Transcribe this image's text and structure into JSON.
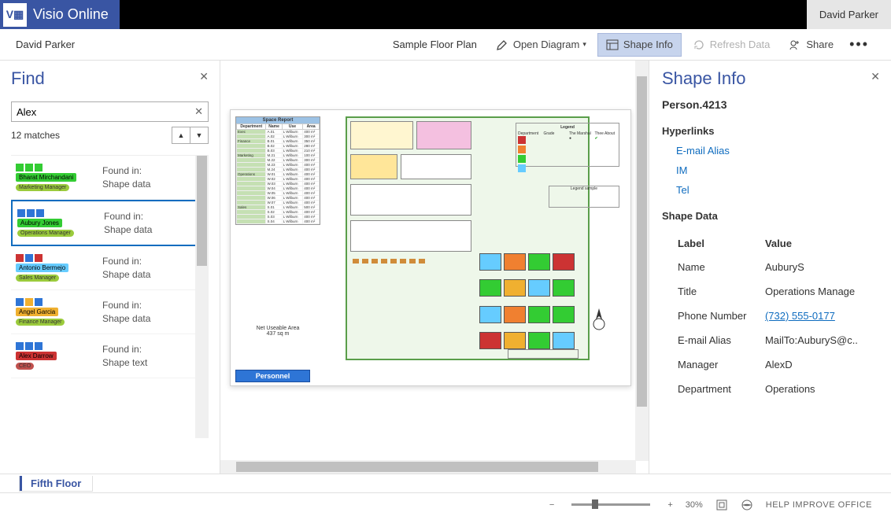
{
  "app": {
    "name": "Visio Online",
    "user": "David Parker"
  },
  "cmdbar": {
    "user": "David Parker",
    "docTitle": "Sample Floor Plan",
    "openDiagram": "Open Diagram",
    "shapeInfo": "Shape Info",
    "refreshData": "Refresh Data",
    "share": "Share"
  },
  "find": {
    "title": "Find",
    "query": "Alex",
    "matchesLabel": "12 matches",
    "foundInLabel": "Found in:",
    "shapeDataLabel": "Shape data",
    "shapeTextLabel": "Shape text",
    "results": [
      {
        "name": "Bharat Mirchandani",
        "role": "Marketing Manager",
        "nameBg": "#33cc33",
        "roleBg": "#9bcb3c",
        "squares": [
          "#33cc33",
          "#33cc33",
          "#33cc33"
        ],
        "detail": "Shape data",
        "selected": false
      },
      {
        "name": "Aubury Jones",
        "role": "Operations Manager",
        "nameBg": "#33cc33",
        "roleBg": "#9bcb3c",
        "squares": [
          "#2e75d6",
          "#2e75d6",
          "#2e75d6"
        ],
        "detail": "Shape data",
        "selected": true
      },
      {
        "name": "Antonio Bermejo",
        "role": "Sales Manager",
        "nameBg": "#66ccff",
        "roleBg": "#9bcb3c",
        "squares": [
          "#cc3333",
          "#2e75d6",
          "#cc3333"
        ],
        "detail": "Shape data",
        "selected": false
      },
      {
        "name": "Angel Garcia",
        "role": "Finance Manager",
        "nameBg": "#f0b030",
        "roleBg": "#9bcb3c",
        "squares": [
          "#2e75d6",
          "#f0b030",
          "#2e75d6"
        ],
        "detail": "Shape data",
        "selected": false
      },
      {
        "name": "Alex Darrow",
        "role": "CEO",
        "nameBg": "#cc3333",
        "roleBg": "#c0504d",
        "squares": [
          "#2e75d6",
          "#2e75d6",
          "#2e75d6"
        ],
        "detail": "Shape text",
        "selected": false
      }
    ]
  },
  "canvas": {
    "spaceReportTitle": "Space Report",
    "spaceReportHeaders": [
      "Department",
      "Name",
      "Use",
      "Area"
    ],
    "spaceReportDepts": [
      "Exec",
      "Finance",
      "Marketing",
      "Operations",
      "Sales"
    ],
    "netAreaLabel": "Net Useable Area",
    "netAreaValue": "437 sq m",
    "personnelBtn": "Personnel",
    "legendTitle": "Legend",
    "legendCols": [
      "Department",
      "Grade",
      "The Marshal",
      "Thee About"
    ],
    "legendSampleTitle": "Legend sample",
    "northPointLabel": "North point"
  },
  "shapeInfo": {
    "title": "Shape Info",
    "shapeName": "Person.4213",
    "hyperlinksTitle": "Hyperlinks",
    "links": [
      "E-mail Alias",
      "IM",
      "Tel"
    ],
    "shapeDataTitle": "Shape Data",
    "tableHeaders": {
      "label": "Label",
      "value": "Value"
    },
    "rows": [
      {
        "label": "Name",
        "value": "AuburyS",
        "link": false
      },
      {
        "label": "Title",
        "value": "Operations Manage",
        "link": false
      },
      {
        "label": "Phone Number",
        "value": "(732) 555-0177",
        "link": true
      },
      {
        "label": "E-mail Alias",
        "value": "MailTo:AuburyS@c..",
        "link": false
      },
      {
        "label": "Manager",
        "value": "AlexD",
        "link": false
      },
      {
        "label": "Department",
        "value": "Operations",
        "link": false
      }
    ]
  },
  "tab": {
    "name": "Fifth Floor"
  },
  "status": {
    "zoomPercent": "30%",
    "helpLink": "HELP IMPROVE OFFICE"
  }
}
